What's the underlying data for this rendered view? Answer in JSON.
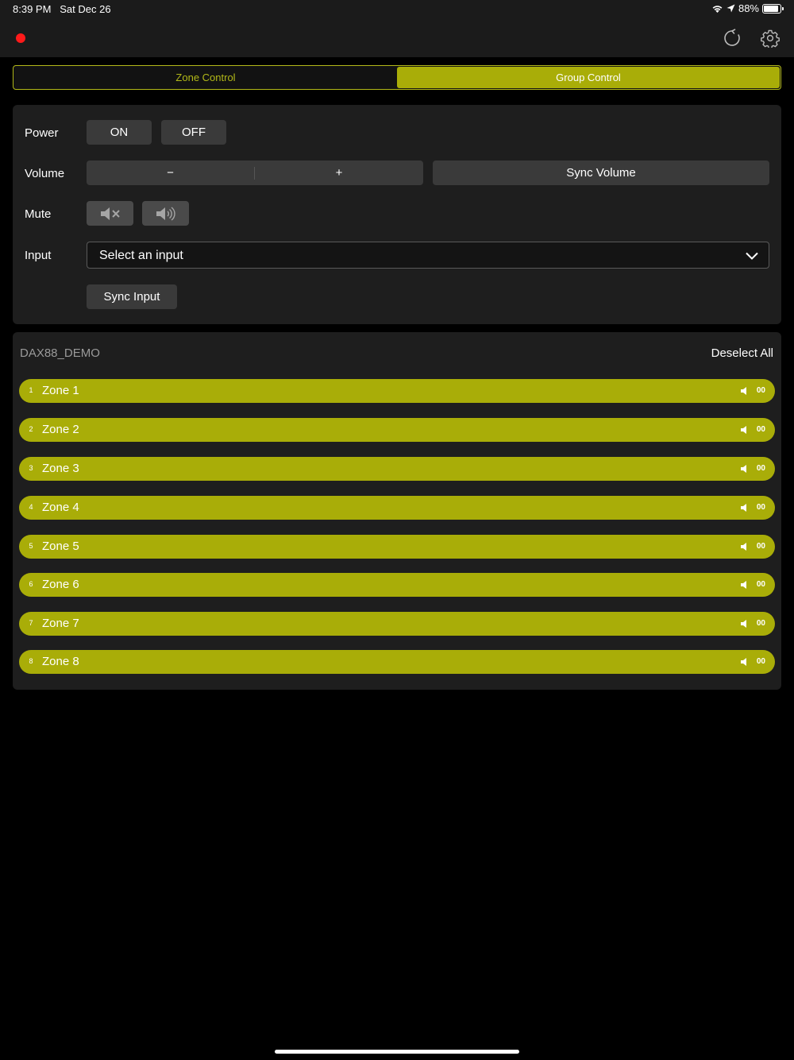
{
  "status": {
    "time": "8:39 PM",
    "date": "Sat Dec 26",
    "battery": "88%",
    "battery_level": 0.88
  },
  "nav": {
    "record_color": "#ff1a1a",
    "refresh_icon": "refresh-icon",
    "settings_icon": "gear-icon"
  },
  "tabs": {
    "zone_control": "Zone Control",
    "group_control": "Group Control",
    "active": "group_control"
  },
  "controls": {
    "power_label": "Power",
    "on_label": "ON",
    "off_label": "OFF",
    "volume_label": "Volume",
    "volume_down": "−",
    "volume_up": "+",
    "sync_volume_label": "Sync Volume",
    "mute_label": "Mute",
    "mute_icon": "speaker-muted-icon",
    "unmute_icon": "speaker-sound-icon",
    "input_label": "Input",
    "input_placeholder": "Select an input",
    "sync_input_label": "Sync Input"
  },
  "zones_panel": {
    "system_name": "DAX88_DEMO",
    "deselect_label": "Deselect All",
    "zones": [
      {
        "num": "1",
        "name": "Zone 1",
        "volume": "00"
      },
      {
        "num": "2",
        "name": "Zone 2",
        "volume": "00"
      },
      {
        "num": "3",
        "name": "Zone 3",
        "volume": "00"
      },
      {
        "num": "4",
        "name": "Zone 4",
        "volume": "00"
      },
      {
        "num": "5",
        "name": "Zone 5",
        "volume": "00"
      },
      {
        "num": "6",
        "name": "Zone 6",
        "volume": "00"
      },
      {
        "num": "7",
        "name": "Zone 7",
        "volume": "00"
      },
      {
        "num": "8",
        "name": "Zone 8",
        "volume": "00"
      }
    ]
  },
  "colors": {
    "accent": "#a9ad08",
    "accent_text": "#b2b818",
    "background": "#000000",
    "card": "#1e1e1e",
    "button": "#3a3a3a"
  }
}
